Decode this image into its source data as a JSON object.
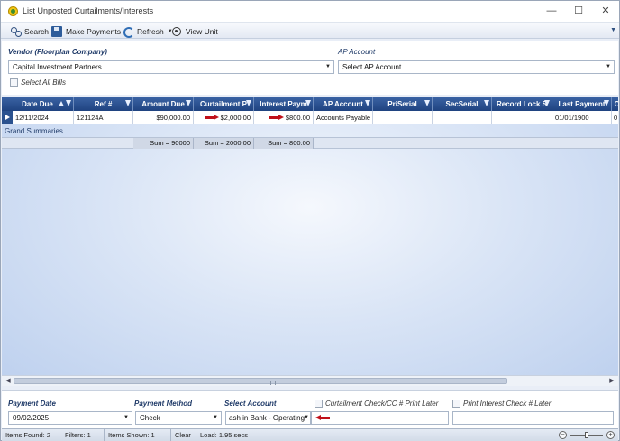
{
  "window": {
    "title": "List Unposted Curtailments/Interests",
    "min_glyph": "—",
    "max_glyph": "☐",
    "close_glyph": "✕"
  },
  "toolbar": {
    "search_label": "Search",
    "make_payments_label": "Make Payments",
    "refresh_label": "Refresh",
    "view_unit_label": "View Unit"
  },
  "filters": {
    "vendor_label": "Vendor (Floorplan Company)",
    "vendor_value": "Capital Investment Partners",
    "ap_account_label": "AP Account",
    "ap_account_value": "Select AP Account",
    "select_all_label": "Select All Bills"
  },
  "grid": {
    "columns": [
      "Date Due",
      "Ref #",
      "Amount Due",
      "Curtailment P",
      "Interest Paym",
      "AP Account",
      "PriSerial",
      "SecSerial",
      "Record Lock S",
      "Last Payment",
      "C"
    ],
    "rows": [
      {
        "date_due": "12/11/2024",
        "ref": "121124A",
        "amount_due": "$90,000.00",
        "curtailment": "$2,000.00",
        "interest": "$800.00",
        "ap_account": "Accounts Payable",
        "pri_serial": "",
        "sec_serial": "",
        "record_lock": "",
        "last_payment": "01/01/1900",
        "c": "0"
      }
    ],
    "summary_label": "Grand Summaries",
    "summaries": {
      "amount_due": "Sum = 90000",
      "curtailment": "Sum = 2000.00",
      "interest": "Sum = 800.00"
    }
  },
  "payment": {
    "date_label": "Payment Date",
    "date_value": "09/02/2025",
    "method_label": "Payment Method",
    "method_value": "Check",
    "account_label": "Select Account",
    "account_value": "ash in Bank - Operating",
    "curt_check_label": "Curtailment Check/CC # Print Later",
    "interest_check_label": "Print Interest Check # Later"
  },
  "status": {
    "items_found": "Items Found: 2",
    "filters": "Filters: 1",
    "items_shown": "Items Shown: 1",
    "clear": "Clear",
    "load": "Load: 1.95 secs"
  },
  "icons": {
    "app": "app-coin-icon",
    "search": "binoculars-icon",
    "make_payments": "save-disk-icon",
    "refresh": "refresh-icon",
    "view_unit": "steering-wheel-icon",
    "highlight_arrows": "red-arrow-icon"
  },
  "colors": {
    "header_blue": "#1f4380",
    "highlight_red": "#c0101a",
    "label_blue": "#1f3a68"
  }
}
